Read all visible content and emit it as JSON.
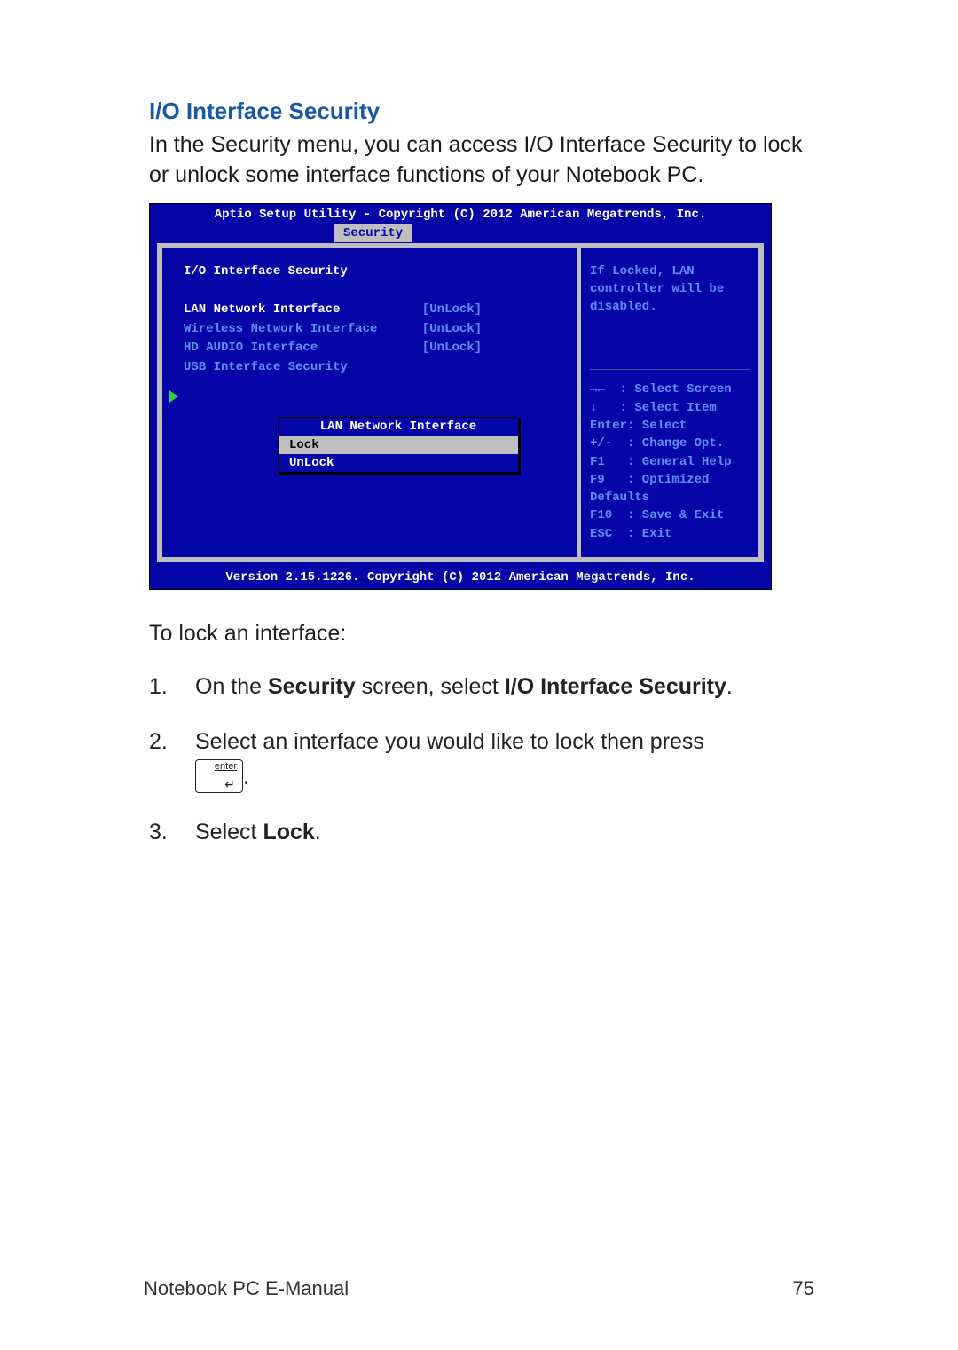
{
  "heading": "I/O Interface Security",
  "intro": "In the Security menu, you can access I/O Interface Security to lock or unlock some interface functions of your Notebook PC.",
  "bios": {
    "header": "Aptio Setup Utility - Copyright (C) 2012 American Megatrends, Inc.",
    "tab": "Security",
    "section_title": "I/O Interface Security",
    "items": [
      {
        "key": "LAN Network Interface",
        "value": "[UnLock]",
        "highlight": true
      },
      {
        "key": "Wireless Network Interface",
        "value": "[UnLock]",
        "highlight": false
      },
      {
        "key": "HD AUDIO Interface",
        "value": "[UnLock]",
        "highlight": false
      },
      {
        "key": "USB Interface Security",
        "value": "",
        "highlight": false
      }
    ],
    "popup": {
      "title": "LAN Network Interface",
      "options": [
        {
          "label": "Lock",
          "selected": true
        },
        {
          "label": "UnLock",
          "selected": false
        }
      ]
    },
    "help_top": "If Locked, LAN controller will be disabled.",
    "help_keys": "→←  : Select Screen\n↓   : Select Item\nEnter: Select\n+/-  : Change Opt.\nF1   : General Help\nF9   : Optimized\nDefaults\nF10  : Save & Exit\nESC  : Exit",
    "footer": "Version 2.15.1226. Copyright (C) 2012 American Megatrends, Inc."
  },
  "instr_lead": "To lock an interface:",
  "steps": {
    "s1_a": "On the ",
    "s1_b": "Security",
    "s1_c": " screen, select ",
    "s1_d": "I/O Interface Security",
    "s1_e": ".",
    "s2": "Select an interface you would like to lock then press ",
    "s2_key": "enter",
    "s2_end": ".",
    "s3_a": "Select ",
    "s3_b": "Lock",
    "s3_c": "."
  },
  "footer_text": "Notebook PC E-Manual",
  "page_number": "75"
}
